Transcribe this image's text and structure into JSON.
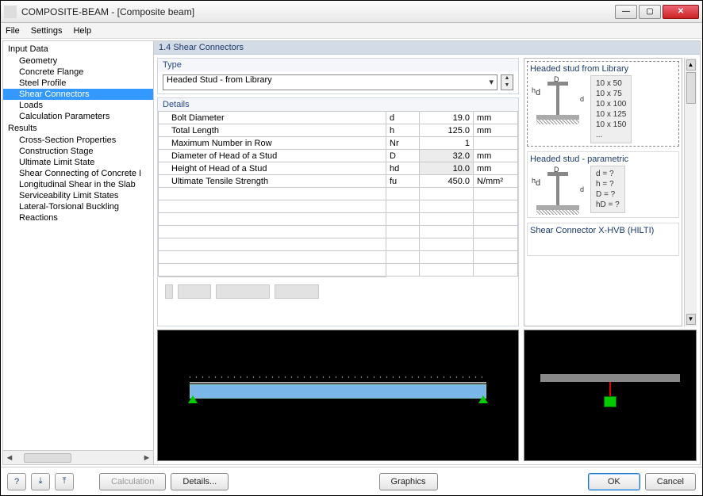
{
  "window": {
    "title": "COMPOSITE-BEAM - [Composite beam]"
  },
  "menu": {
    "file": "File",
    "settings": "Settings",
    "help": "Help"
  },
  "tree": {
    "input_label": "Input Data",
    "items_input": [
      "Geometry",
      "Concrete Flange",
      "Steel Profile",
      "Shear Connectors",
      "Loads",
      "Calculation Parameters"
    ],
    "results_label": "Results",
    "items_results": [
      "Cross-Section Properties",
      "Construction Stage",
      "Ultimate Limit State",
      "Shear Connecting of Concrete I",
      "Longitudinal Shear in the Slab",
      "Serviceability Limit States",
      "Lateral-Torsional Buckling",
      "Reactions"
    ],
    "selected": "Shear Connectors"
  },
  "section": {
    "title": "1.4 Shear Connectors"
  },
  "type": {
    "label": "Type",
    "value": "Headed Stud - from Library"
  },
  "details": {
    "label": "Details",
    "rows": [
      {
        "name": "Bolt Diameter",
        "sym": "d",
        "val": "19.0",
        "unit": "mm",
        "shade": false
      },
      {
        "name": "Total Length",
        "sym": "h",
        "val": "125.0",
        "unit": "mm",
        "shade": false
      },
      {
        "name": "Maximum Number in Row",
        "sym": "Nr",
        "val": "1",
        "unit": "",
        "shade": false
      },
      {
        "name": "Diameter of Head of a Stud",
        "sym": "D",
        "val": "32.0",
        "unit": "mm",
        "shade": true
      },
      {
        "name": "Height of Head of a Stud",
        "sym": "hd",
        "val": "10.0",
        "unit": "mm",
        "shade": true
      },
      {
        "name": "Ultimate Tensile Strength",
        "sym": "fu",
        "val": "450.0",
        "unit": "N/mm²",
        "shade": false
      }
    ]
  },
  "library": {
    "item1": {
      "title": "Headed stud from Library",
      "sizes": [
        "10 x 50",
        "10 x 75",
        "10 x 100",
        "10 x 125",
        "10 x 150",
        "..."
      ]
    },
    "item2": {
      "title": "Headed stud - parametric",
      "params": [
        "d   = ?",
        "h   = ?",
        "D   = ?",
        "hD = ?"
      ]
    },
    "item3": {
      "title": "Shear Connector X-HVB (HILTI)"
    }
  },
  "buttons": {
    "calc": "Calculation",
    "details": "Details...",
    "graphics": "Graphics",
    "ok": "OK",
    "cancel": "Cancel"
  }
}
